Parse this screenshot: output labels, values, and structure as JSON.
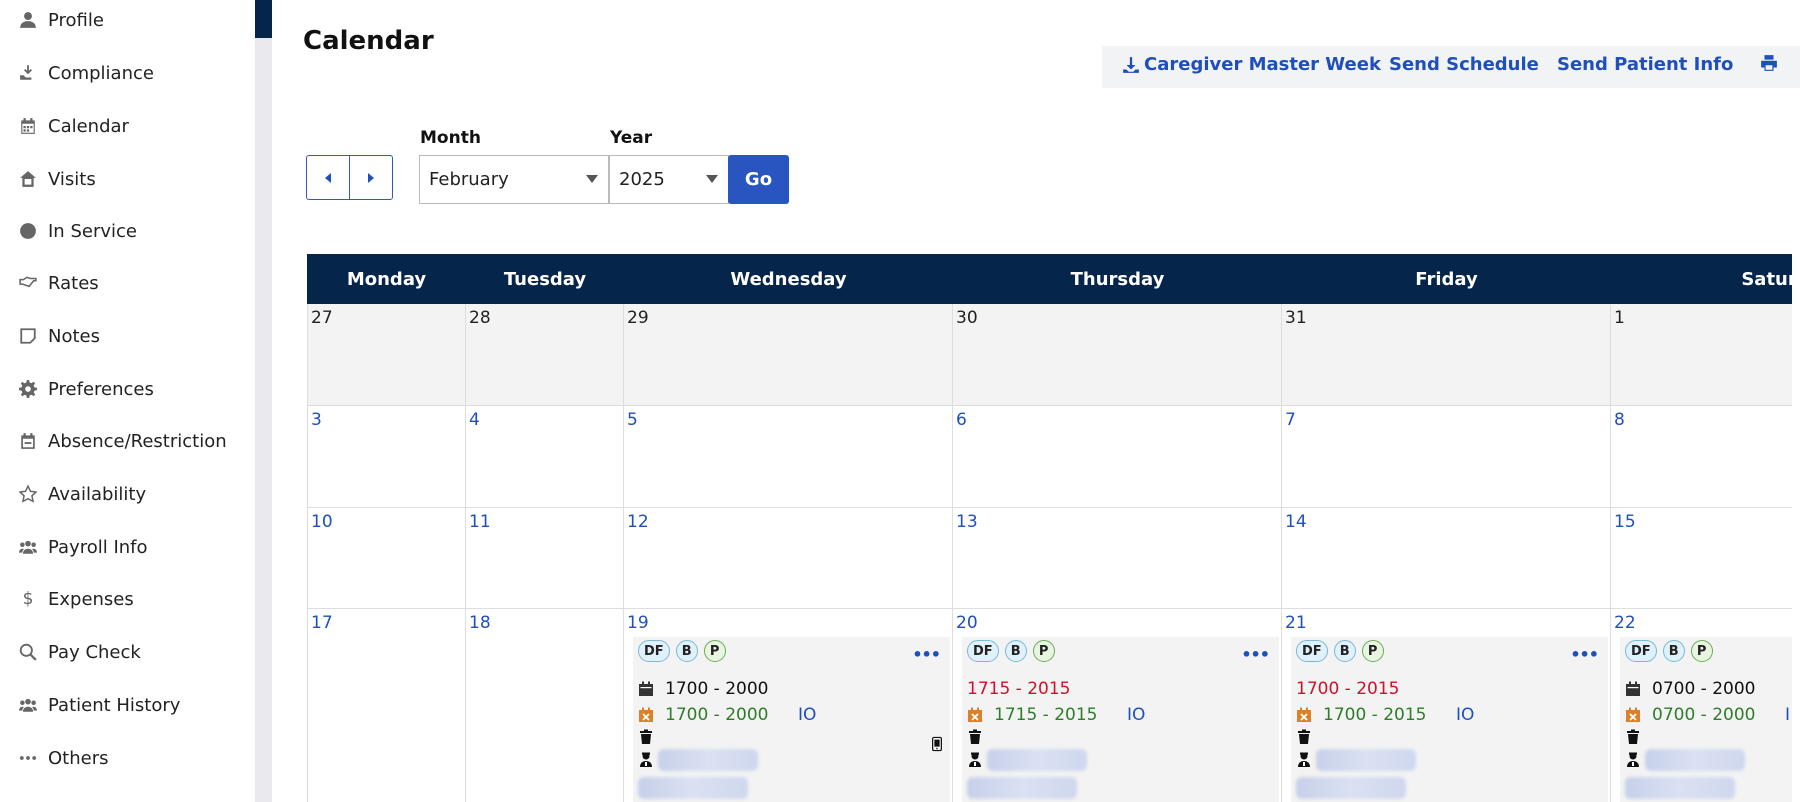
{
  "sidebar": {
    "items": [
      {
        "label": "Profile",
        "icon": "person-icon"
      },
      {
        "label": "Compliance",
        "icon": "hand-tray-icon"
      },
      {
        "label": "Calendar",
        "icon": "calendar-icon"
      },
      {
        "label": "Visits",
        "icon": "house-icon"
      },
      {
        "label": "In Service",
        "icon": "circle-icon"
      },
      {
        "label": "Rates",
        "icon": "handshake-icon"
      },
      {
        "label": "Notes",
        "icon": "note-icon"
      },
      {
        "label": "Preferences",
        "icon": "gear-icon"
      },
      {
        "label": "Absence/Restriction",
        "icon": "calendar-minus-icon"
      },
      {
        "label": "Availability",
        "icon": "star-icon"
      },
      {
        "label": "Payroll Info",
        "icon": "users-icon"
      },
      {
        "label": "Expenses",
        "icon": "dollar-icon"
      },
      {
        "label": "Pay Check",
        "icon": "search-dollar-icon"
      },
      {
        "label": "Patient History",
        "icon": "users-icon"
      },
      {
        "label": "Others",
        "icon": "ellipsis-icon"
      }
    ]
  },
  "header": {
    "title": "Calendar",
    "caregiver_master_week": "Caregiver Master Week",
    "send_schedule": "Send Schedule",
    "send_patient_info": "Send Patient Info"
  },
  "filters": {
    "month_label": "Month",
    "month_value": "February",
    "year_label": "Year",
    "year_value": "2025",
    "go_label": "Go"
  },
  "calendar": {
    "days": [
      "Monday",
      "Tuesday",
      "Wednesday",
      "Thursday",
      "Friday",
      "Saturd"
    ],
    "weeks": [
      [
        "27",
        "28",
        "29",
        "30",
        "31",
        "1"
      ],
      [
        "3",
        "4",
        "5",
        "6",
        "7",
        "8"
      ],
      [
        "10",
        "11",
        "12",
        "13",
        "14",
        "15"
      ],
      [
        "17",
        "18",
        "19",
        "20",
        "21",
        "22"
      ]
    ],
    "visits": [
      {
        "badges": [
          "DF",
          "B",
          "P"
        ],
        "scheduled": "1700 - 2000",
        "scheduled_late": false,
        "actual": "1700 - 2000",
        "io": "IO",
        "phone": true
      },
      {
        "badges": [
          "DF",
          "B",
          "P"
        ],
        "scheduled": "1715 - 2015",
        "scheduled_late": true,
        "actual": "1715 - 2015",
        "io": "IO",
        "phone": false
      },
      {
        "badges": [
          "DF",
          "B",
          "P"
        ],
        "scheduled": "1700 - 2015",
        "scheduled_late": true,
        "actual": "1700 - 2015",
        "io": "IO",
        "phone": false
      },
      {
        "badges": [
          "DF",
          "B",
          "P"
        ],
        "scheduled": "0700 - 2000",
        "scheduled_late": false,
        "actual": "0700 - 2000",
        "io": "I",
        "phone": false
      }
    ]
  },
  "colors": {
    "navy": "#06254a",
    "link_blue": "#1f4fbb",
    "late_red": "#d0112b",
    "actual_green": "#2f7d2b"
  }
}
